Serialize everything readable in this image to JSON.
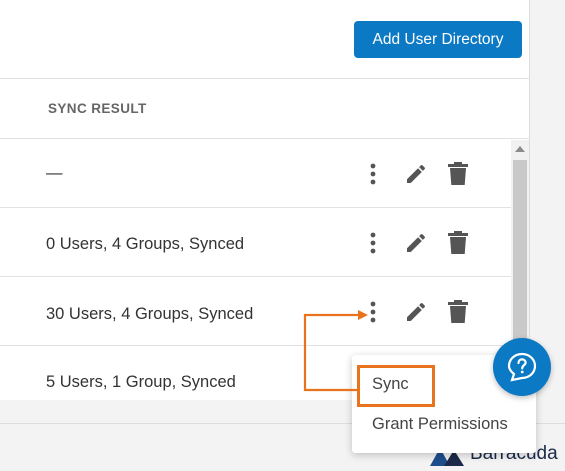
{
  "toolbar": {
    "add_directory_label": "Add User Directory"
  },
  "table": {
    "column_header": "SYNC RESULT",
    "rows": [
      {
        "sync_result": "—"
      },
      {
        "sync_result": "0 Users, 4 Groups, Synced"
      },
      {
        "sync_result": "30 Users, 4 Groups, Synced"
      },
      {
        "sync_result": "5 Users, 1 Group, Synced"
      }
    ]
  },
  "context_menu": {
    "items": [
      {
        "label": "Sync"
      },
      {
        "label": "Grant Permissions"
      }
    ]
  },
  "footer": {
    "brand": "Barracuda"
  },
  "icons": [
    "more-vertical-icon",
    "pencil-icon",
    "trash-icon",
    "help-icon",
    "barracuda-logo"
  ],
  "colors": {
    "primary": "#0b79c4",
    "annotation": "#e8731c"
  }
}
